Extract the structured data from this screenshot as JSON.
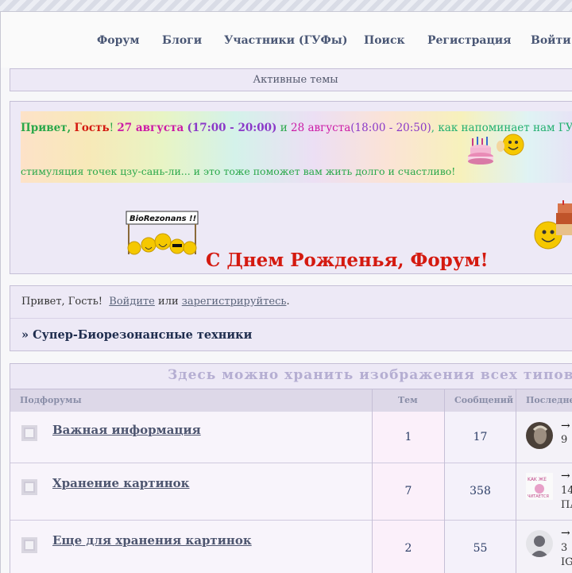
{
  "nav": {
    "items": [
      "Форум",
      "Блоги",
      "Участники (ГУФы)",
      "Поиск",
      "Регистрация",
      "Войти"
    ]
  },
  "active_topics": "Активные темы",
  "banner": {
    "greet_prefix": "Привет,",
    "guest": "Гость",
    "excl": "!",
    "date1": "27 августа",
    "time1": "(17:00 - 20:00)",
    "and": "и",
    "date2": "28 августа",
    "time2": "(18:00 - 20:50)",
    "reminder": ", как напоминает нам ГУФ D",
    "line2": "стимуляция точек цзу-сань-ли... и это тоже поможет вам жить долго и счастливо!",
    "sign_text": "BioRezonans !!",
    "birthday": "С Днем Рожденья, Форум!"
  },
  "welcome": {
    "hello": "Привет, Гость!",
    "login": "Войдите",
    "or": "или",
    "register": "зарегистрируйтесь",
    "dot": ".",
    "crumb": "» Супер-Биорезонансные техники"
  },
  "forum": {
    "title": "Здесь можно хранить изображения всех типов",
    "headers": {
      "subforums": "Подфорумы",
      "topics": "Тем",
      "messages": "Сообщений",
      "last": "Последне"
    },
    "rows": [
      {
        "name": "Важная информация",
        "topics": "1",
        "messages": "17",
        "last_arrow": "→",
        "last_l1": "9 ",
        "last_l2": ""
      },
      {
        "name": "Хранение картинок",
        "topics": "7",
        "messages": "358",
        "last_arrow": "→",
        "last_l1": "14",
        "last_l2": "ПА"
      },
      {
        "name": "Еще для хранения картинок",
        "topics": "2",
        "messages": "55",
        "last_arrow": "→",
        "last_l1": "3 ",
        "last_l2": "IG"
      }
    ]
  },
  "colors": {
    "nav_text": "#4a5775",
    "panel_bg": "#ede9f6",
    "birthday_red": "#d41a10",
    "greet_green": "#2aa84a",
    "date_magenta": "#cc1aa6",
    "time_purple": "#8a38c8"
  }
}
